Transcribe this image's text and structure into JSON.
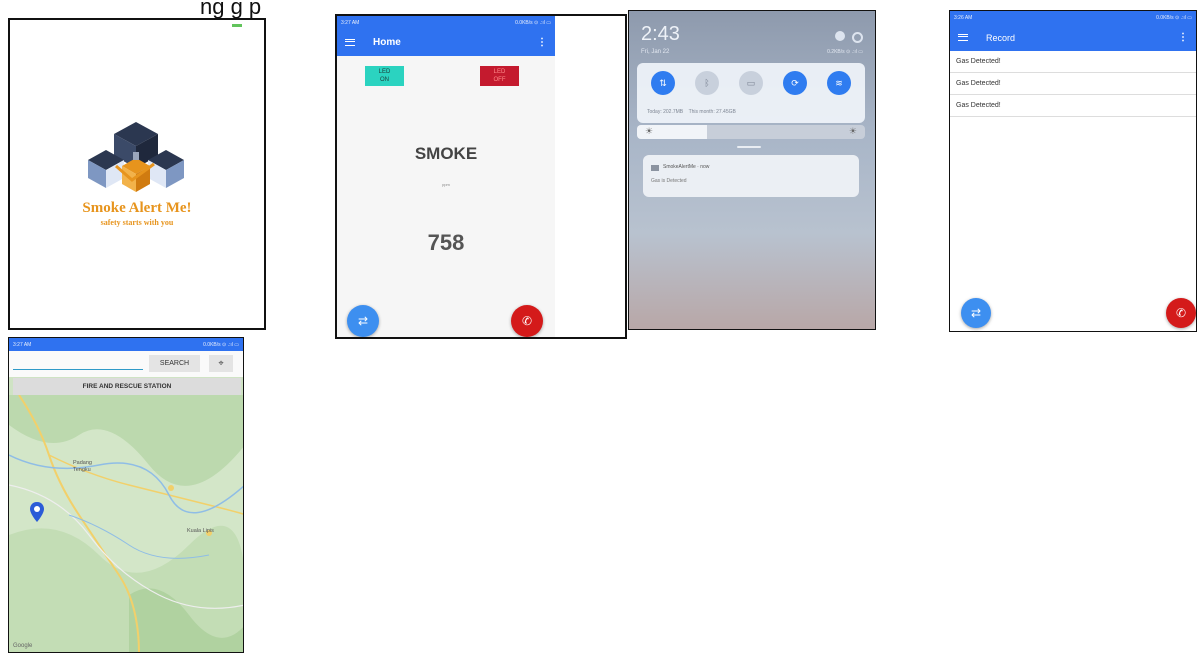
{
  "caption": "ng   g  p",
  "colors": {
    "primary": "#2f72f0",
    "fab_blue": "#3d8ff0",
    "fab_red": "#d41a1a",
    "led_on": "#2bd3c0",
    "led_off": "#c41a2e",
    "logo_orange": "#e7941d",
    "logo_navy": "#2b3750"
  },
  "icons": {
    "fab_left": "swap-icon",
    "fab_right": "phone-icon",
    "menu": "hamburger-icon",
    "more": "kebab-icon",
    "pin": "map-pin-icon"
  },
  "splash": {
    "title": "Smoke Alert Me!",
    "subtitle": "safety starts with you"
  },
  "home": {
    "status_time": "3:27 AM",
    "status_right": "0.0KB/s ⊙ .:ıl ▭",
    "title": "Home",
    "led_on": "LED\nON",
    "led_off": "LED\nOFF",
    "smoke_label": "SMOKE",
    "smoke_sub": "ppm",
    "smoke_value": "758"
  },
  "notif": {
    "time": "2:43",
    "date": "Fri, Jan 22",
    "status_right": "0.2KB/s ⊙ .:ıl ▭",
    "data_usage": "Today: 202.7MB    This month: 27.45GB",
    "app_notif_title": "SmokeAlertMe · now",
    "app_notif_body": "Gas is Detected"
  },
  "record": {
    "status_time": "3:26 AM",
    "status_right": "0.0KB/s ⊙ .:ıl ▭",
    "title": "Record",
    "items": [
      "Gas Detected!",
      "Gas Detected!",
      "Gas Detected!"
    ]
  },
  "map": {
    "status_time": "3:27 AM",
    "status_right": "0.0KB/s ⊙ .:ıl ▭",
    "search_button": "SEARCH",
    "banner": "FIRE AND RESCUE STATION",
    "place_1": "Padang\nTengku",
    "place_2": "Kuala Lipis",
    "attribution": "Google"
  }
}
